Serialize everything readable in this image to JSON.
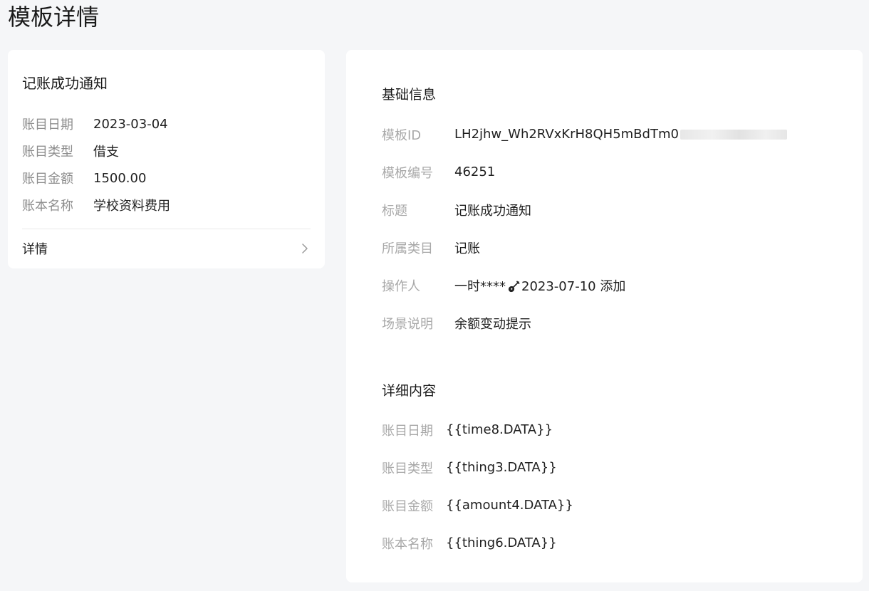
{
  "page": {
    "title": "模板详情"
  },
  "preview": {
    "title": "记账成功通知",
    "fields": [
      {
        "label": "账目日期",
        "value": "2023-03-04"
      },
      {
        "label": "账目类型",
        "value": "借支"
      },
      {
        "label": "账目金额",
        "value": "1500.00"
      },
      {
        "label": "账本名称",
        "value": "学校资料费用"
      }
    ],
    "detail_label": "详情"
  },
  "basic_info": {
    "heading": "基础信息",
    "template_id": {
      "label": "模板ID",
      "value": "LH2jhw_Wh2RVxKrH8QH5mBdTm0"
    },
    "template_number": {
      "label": "模板编号",
      "value": "46251"
    },
    "title": {
      "label": "标题",
      "value": "记账成功通知"
    },
    "category": {
      "label": "所属类目",
      "value": "记账"
    },
    "operator": {
      "label": "操作人",
      "name": "一时****",
      "date_action": "2023-07-10 添加"
    },
    "scene": {
      "label": "场景说明",
      "value": "余额变动提示"
    }
  },
  "detail_content": {
    "heading": "详细内容",
    "rows": [
      {
        "label": "账目日期",
        "value": "{{time8.DATA}}"
      },
      {
        "label": "账目类型",
        "value": "{{thing3.DATA}}"
      },
      {
        "label": "账目金额",
        "value": "{{amount4.DATA}}"
      },
      {
        "label": "账本名称",
        "value": "{{thing6.DATA}}"
      }
    ]
  },
  "icons": {
    "detail_chevron": "chevron-right-icon",
    "operator_emoji": "guitar-icon"
  }
}
